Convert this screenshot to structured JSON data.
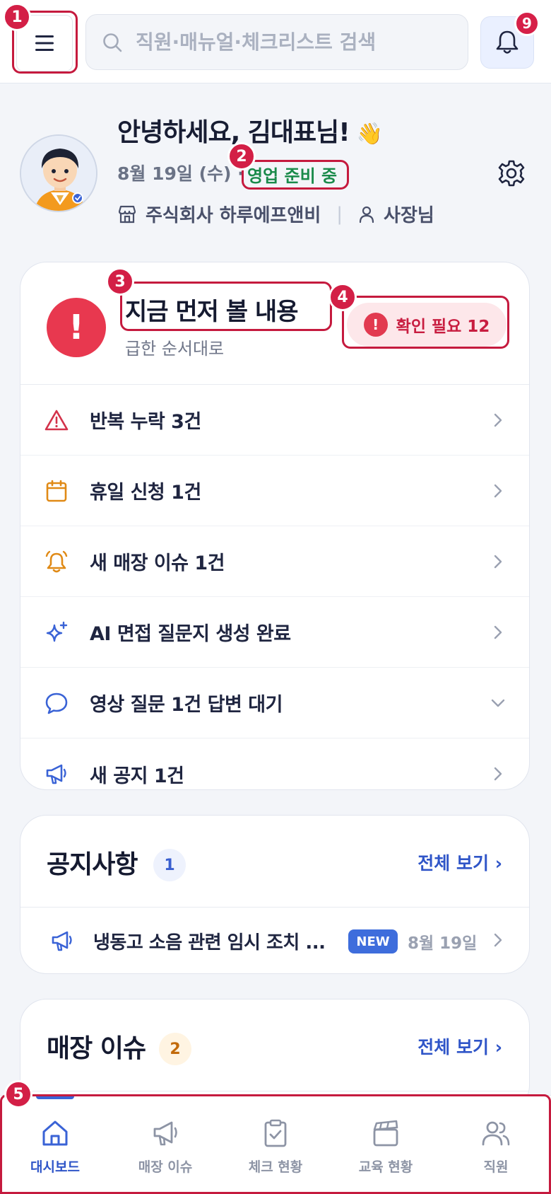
{
  "header": {
    "menu_icon": "hamburger-menu-icon",
    "search_placeholder": "직원·매뉴얼·체크리스트 검색",
    "search_icon": "search-icon",
    "notification_icon": "bell-icon",
    "notification_count": "9"
  },
  "annotations": [
    "1",
    "2",
    "3",
    "4",
    "5"
  ],
  "greeting": {
    "title": "안녕하세요, 김대표님!",
    "wave_emoji": "👋",
    "date": "8월 19일 (수) ·",
    "status": "영업 준비 중",
    "company_icon": "store-icon",
    "company": "주식회사 하루에프앤비",
    "separator": "|",
    "role_icon": "person-icon",
    "role": "사장님",
    "settings_icon": "gear-icon"
  },
  "priority": {
    "alert_symbol": "!",
    "title": "지금 먼저 볼 내용",
    "subtitle": "급한 순서대로",
    "badge_symbol": "!",
    "badge_label": "확인 필요 12",
    "items": [
      {
        "label": "반복 누락 3건",
        "icon": "warning-triangle-icon",
        "chevron": "right"
      },
      {
        "label": "휴일 신청 1건",
        "icon": "calendar-icon",
        "chevron": "right"
      },
      {
        "label": "새 매장 이슈 1건",
        "icon": "alarm-bell-icon",
        "chevron": "right"
      },
      {
        "label": "AI 면접 질문지 생성 완료",
        "icon": "sparkle-icon",
        "chevron": "right"
      },
      {
        "label": "영상 질문 1건 답변 대기",
        "icon": "chat-bubble-icon",
        "chevron": "down"
      },
      {
        "label": "새 공지 1건",
        "icon": "megaphone-icon",
        "chevron": "right"
      }
    ]
  },
  "notices": {
    "title": "공지사항",
    "count": "1",
    "view_all": "전체 보기 ›",
    "items": [
      {
        "text": "냉동고 소음 관련 임시 조치 ...",
        "badge": "NEW",
        "date": "8월 19일"
      }
    ]
  },
  "issues": {
    "title": "매장 이슈",
    "count": "2",
    "view_all": "전체 보기 ›"
  },
  "bottom_nav": [
    {
      "label": "대시보드",
      "icon": "home-icon",
      "active": true
    },
    {
      "label": "매장 이슈",
      "icon": "megaphone-icon",
      "active": false
    },
    {
      "label": "체크 현황",
      "icon": "clipboard-check-icon",
      "active": false
    },
    {
      "label": "교육 현황",
      "icon": "clapperboard-icon",
      "active": false
    },
    {
      "label": "직원",
      "icon": "people-icon",
      "active": false
    }
  ],
  "colors": {
    "accent": "#2f55c8",
    "alert": "#e8384f",
    "marker": "#d31f46",
    "status_green": "#1a8a4a",
    "background": "#f3f5f9"
  }
}
